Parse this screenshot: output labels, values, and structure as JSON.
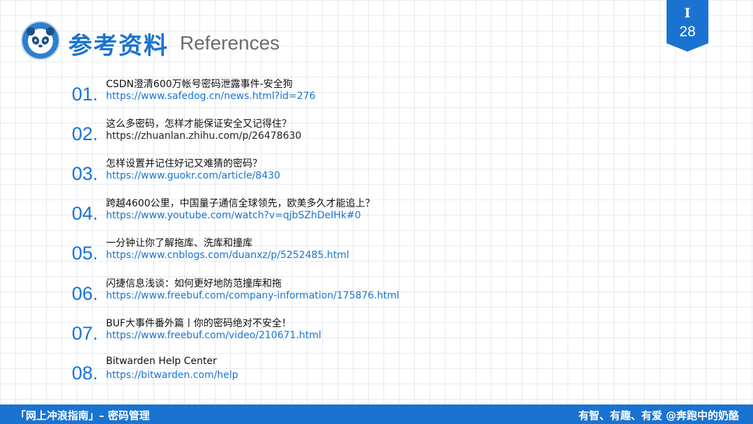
{
  "header": {
    "title_cn": "参考资料",
    "title_en": "References",
    "page_label": "I",
    "page_number": "28"
  },
  "references": [
    {
      "num": "01.",
      "title": "CSDN澄清600万帐号密码泄露事件-安全狗",
      "url": "https://www.safedog.cn/news.html?id=276"
    },
    {
      "num": "02.",
      "title": "这么多密码，怎样才能保证安全又记得住？",
      "url": "https://zhuanlan.zhihu.com/p/26478630"
    },
    {
      "num": "03.",
      "title": "怎样设置并记住好记又难猜的密码？",
      "url": "https://www.guokr.com/article/8430"
    },
    {
      "num": "04.",
      "title": "跨越4600公里，中国量子通信全球领先，欧美多久才能追上？",
      "url": "https://www.youtube.com/watch?v=qjbSZhDeIHk#0"
    },
    {
      "num": "05.",
      "title": "一分钟让你了解拖库、洗库和撞库",
      "url": "https://www.cnblogs.com/duanxz/p/5252485.html"
    },
    {
      "num": "06.",
      "title": "闪捷信息浅谈：如何更好地防范撞库和拖",
      "url": "https://www.freebuf.com/company-information/175876.html"
    },
    {
      "num": "07.",
      "title": "BUF大事件番外篇丨你的密码绝对不安全！",
      "url": "https://www.freebuf.com/video/210671.html"
    },
    {
      "num": "08.",
      "title": "Bitwarden Help Center",
      "url": "https://bitwarden.com/help"
    }
  ],
  "footer": {
    "left": "「网上冲浪指南」– 密码管理",
    "right": "有智、有趣、有爱    @奔跑中的奶酪"
  },
  "colors": {
    "accent": "#1a73d1",
    "grid": "#e6ebf1"
  },
  "icons": {
    "logo": "panda-icon"
  }
}
